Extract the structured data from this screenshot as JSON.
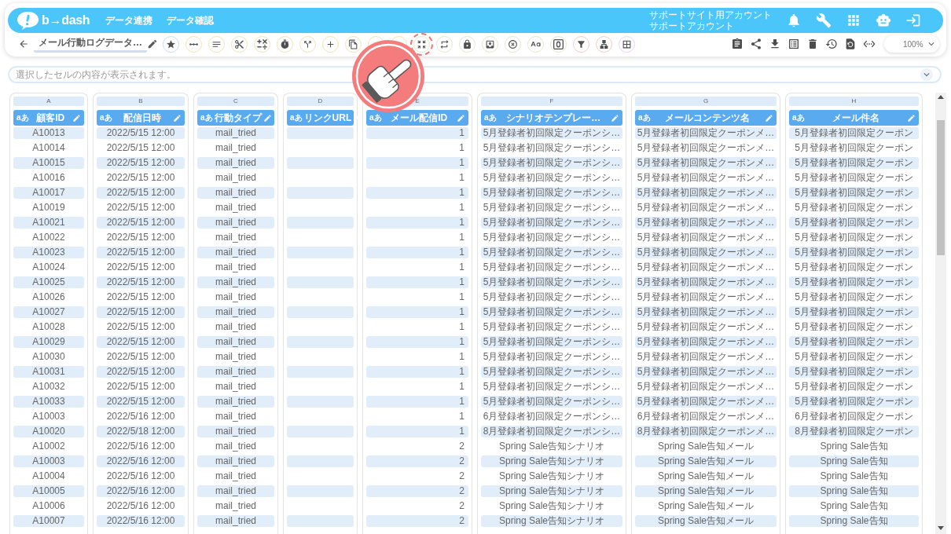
{
  "header": {
    "logo": "b→dash",
    "nav": [
      {
        "label": "データ連携"
      },
      {
        "label": "データ確認"
      }
    ],
    "account": {
      "site": "サポートサイト用アカウント",
      "user": "サポートアカウント"
    }
  },
  "toolbar": {
    "title": "メール行動ログデータ…",
    "tools": [
      {
        "color": "#c8daee",
        "highlighted": false
      },
      {
        "color": "#f3e2b3",
        "highlighted": false
      },
      {
        "color": "#f3e2b3",
        "highlighted": false
      },
      {
        "color": "#f3e2b3",
        "highlighted": false
      },
      {
        "color": "#f3e2b3",
        "highlighted": false
      },
      {
        "color": "#f3e2b3",
        "highlighted": false
      },
      {
        "color": "#f3e2b3",
        "highlighted": false
      },
      {
        "color": "#f3e2b3",
        "highlighted": false
      },
      {
        "color": "#f3e2b3",
        "highlighted": false
      },
      {
        "color": "#f3e2b3",
        "highlighted": false
      },
      {
        "color": "#f3e2b3",
        "highlighted": false
      },
      {
        "color": "#dfe8cd",
        "highlighted": true
      },
      {
        "color": "#dfe8cd",
        "highlighted": false
      },
      {
        "color": "#dfe8cd",
        "highlighted": false
      },
      {
        "color": "#dfe8cd",
        "highlighted": false
      },
      {
        "color": "#dfe8cd",
        "highlighted": false
      },
      {
        "color": "#dfe8cd",
        "highlighted": false
      },
      {
        "color": "#dfe8cd",
        "highlighted": false
      },
      {
        "color": "#f6c8c8",
        "highlighted": false
      },
      {
        "color": "#f6c8c8",
        "highlighted": false
      },
      {
        "color": "#ecd2f2",
        "highlighted": false
      }
    ],
    "zoom": "100%"
  },
  "formula_bar": {
    "placeholder": "選択したセルの内容が表示されます。"
  },
  "table": {
    "columns": [
      {
        "letter": "A",
        "type_badge": "aあ",
        "name": "顧客ID",
        "kind": "text"
      },
      {
        "letter": "B",
        "type_badge": "aあ",
        "name": "配信日時",
        "kind": "text"
      },
      {
        "letter": "C",
        "type_badge": "aあ",
        "name": "行動タイプ",
        "kind": "text"
      },
      {
        "letter": "D",
        "type_badge": "aあ",
        "name": "リンクURL",
        "kind": "text"
      },
      {
        "letter": "E",
        "type_badge": "aあ",
        "name": "メール配信ID",
        "kind": "number"
      },
      {
        "letter": "F",
        "type_badge": "aあ",
        "name": "シナリオテンプレー…",
        "kind": "text"
      },
      {
        "letter": "G",
        "type_badge": "aあ",
        "name": "メールコンテンツ名",
        "kind": "text"
      },
      {
        "letter": "H",
        "type_badge": "aあ",
        "name": "メール件名",
        "kind": "text"
      }
    ],
    "rows": [
      {
        "cells": [
          "A10013",
          "2022/5/15 12:00",
          "mail_tried",
          null,
          "1",
          "5月登録者初回限定クーポンシ…",
          "5月登録者初回限定クーポンメ…",
          "5月登録者初回限定クーポン"
        ]
      },
      {
        "cells": [
          "A10014",
          "2022/5/15 12:00",
          "mail_tried",
          null,
          "1",
          "5月登録者初回限定クーポンシ…",
          "5月登録者初回限定クーポンメ…",
          "5月登録者初回限定クーポン"
        ]
      },
      {
        "cells": [
          "A10015",
          "2022/5/15 12:00",
          "mail_tried",
          null,
          "1",
          "5月登録者初回限定クーポンシ…",
          "5月登録者初回限定クーポンメ…",
          "5月登録者初回限定クーポン"
        ]
      },
      {
        "cells": [
          "A10016",
          "2022/5/15 12:00",
          "mail_tried",
          null,
          "1",
          "5月登録者初回限定クーポンシ…",
          "5月登録者初回限定クーポンメ…",
          "5月登録者初回限定クーポン"
        ]
      },
      {
        "cells": [
          "A10017",
          "2022/5/15 12:00",
          "mail_tried",
          null,
          "1",
          "5月登録者初回限定クーポンシ…",
          "5月登録者初回限定クーポンメ…",
          "5月登録者初回限定クーポン"
        ]
      },
      {
        "cells": [
          "A10019",
          "2022/5/15 12:00",
          "mail_tried",
          null,
          "1",
          "5月登録者初回限定クーポンシ…",
          "5月登録者初回限定クーポンメ…",
          "5月登録者初回限定クーポン"
        ]
      },
      {
        "cells": [
          "A10021",
          "2022/5/15 12:00",
          "mail_tried",
          null,
          "1",
          "5月登録者初回限定クーポンシ…",
          "5月登録者初回限定クーポンメ…",
          "5月登録者初回限定クーポン"
        ]
      },
      {
        "cells": [
          "A10022",
          "2022/5/15 12:00",
          "mail_tried",
          null,
          "1",
          "5月登録者初回限定クーポンシ…",
          "5月登録者初回限定クーポンメ…",
          "5月登録者初回限定クーポン"
        ]
      },
      {
        "cells": [
          "A10023",
          "2022/5/15 12:00",
          "mail_tried",
          null,
          "1",
          "5月登録者初回限定クーポンシ…",
          "5月登録者初回限定クーポンメ…",
          "5月登録者初回限定クーポン"
        ]
      },
      {
        "cells": [
          "A10024",
          "2022/5/15 12:00",
          "mail_tried",
          null,
          "1",
          "5月登録者初回限定クーポンシ…",
          "5月登録者初回限定クーポンメ…",
          "5月登録者初回限定クーポン"
        ]
      },
      {
        "cells": [
          "A10025",
          "2022/5/15 12:00",
          "mail_tried",
          null,
          "1",
          "5月登録者初回限定クーポンシ…",
          "5月登録者初回限定クーポンメ…",
          "5月登録者初回限定クーポン"
        ]
      },
      {
        "cells": [
          "A10026",
          "2022/5/15 12:00",
          "mail_tried",
          null,
          "1",
          "5月登録者初回限定クーポンシ…",
          "5月登録者初回限定クーポンメ…",
          "5月登録者初回限定クーポン"
        ]
      },
      {
        "cells": [
          "A10027",
          "2022/5/15 12:00",
          "mail_tried",
          null,
          "1",
          "5月登録者初回限定クーポンシ…",
          "5月登録者初回限定クーポンメ…",
          "5月登録者初回限定クーポン"
        ]
      },
      {
        "cells": [
          "A10028",
          "2022/5/15 12:00",
          "mail_tried",
          null,
          "1",
          "5月登録者初回限定クーポンシ…",
          "5月登録者初回限定クーポンメ…",
          "5月登録者初回限定クーポン"
        ]
      },
      {
        "cells": [
          "A10029",
          "2022/5/15 12:00",
          "mail_tried",
          null,
          "1",
          "5月登録者初回限定クーポンシ…",
          "5月登録者初回限定クーポンメ…",
          "5月登録者初回限定クーポン"
        ]
      },
      {
        "cells": [
          "A10030",
          "2022/5/15 12:00",
          "mail_tried",
          null,
          "1",
          "5月登録者初回限定クーポンシ…",
          "5月登録者初回限定クーポンメ…",
          "5月登録者初回限定クーポン"
        ]
      },
      {
        "cells": [
          "A10031",
          "2022/5/15 12:00",
          "mail_tried",
          null,
          "1",
          "5月登録者初回限定クーポンシ…",
          "5月登録者初回限定クーポンメ…",
          "5月登録者初回限定クーポン"
        ]
      },
      {
        "cells": [
          "A10032",
          "2022/5/15 12:00",
          "mail_tried",
          null,
          "1",
          "5月登録者初回限定クーポンシ…",
          "5月登録者初回限定クーポンメ…",
          "5月登録者初回限定クーポン"
        ]
      },
      {
        "cells": [
          "A10033",
          "2022/5/15 12:00",
          "mail_tried",
          null,
          "1",
          "5月登録者初回限定クーポンシ…",
          "5月登録者初回限定クーポンメ…",
          "5月登録者初回限定クーポン"
        ]
      },
      {
        "cells": [
          "A10003",
          "2022/5/16 12:00",
          "mail_tried",
          null,
          "1",
          "6月登録者初回限定クーポンシ…",
          "6月登録者初回限定クーポンメ…",
          "6月登録者初回限定クーポン"
        ]
      },
      {
        "cells": [
          "A10020",
          "2022/5/18 12:00",
          "mail_tried",
          null,
          "1",
          "8月登録者初回限定クーポンシ…",
          "8月登録者初回限定クーポンメ…",
          "8月登録者初回限定クーポン"
        ]
      },
      {
        "cells": [
          "A10002",
          "2022/5/16 12:00",
          "mail_tried",
          null,
          "2",
          "Spring Sale告知シナリオ",
          "Spring Sale告知メール",
          "Spring Sale告知"
        ]
      },
      {
        "cells": [
          "A10003",
          "2022/5/16 12:00",
          "mail_tried",
          null,
          "2",
          "Spring Sale告知シナリオ",
          "Spring Sale告知メール",
          "Spring Sale告知"
        ]
      },
      {
        "cells": [
          "A10004",
          "2022/5/16 12:00",
          "mail_tried",
          null,
          "2",
          "Spring Sale告知シナリオ",
          "Spring Sale告知メール",
          "Spring Sale告知"
        ]
      },
      {
        "cells": [
          "A10005",
          "2022/5/16 12:00",
          "mail_tried",
          null,
          "2",
          "Spring Sale告知シナリオ",
          "Spring Sale告知メール",
          "Spring Sale告知"
        ]
      },
      {
        "cells": [
          "A10006",
          "2022/5/16 12:00",
          "mail_tried",
          null,
          "2",
          "Spring Sale告知シナリオ",
          "Spring Sale告知メール",
          "Spring Sale告知"
        ]
      },
      {
        "cells": [
          "A10007",
          "2022/5/16 12:00",
          "mail_tried",
          null,
          "2",
          "Spring Sale告知シナリオ",
          "Spring Sale告知メール",
          "Spring Sale告知"
        ]
      }
    ]
  }
}
